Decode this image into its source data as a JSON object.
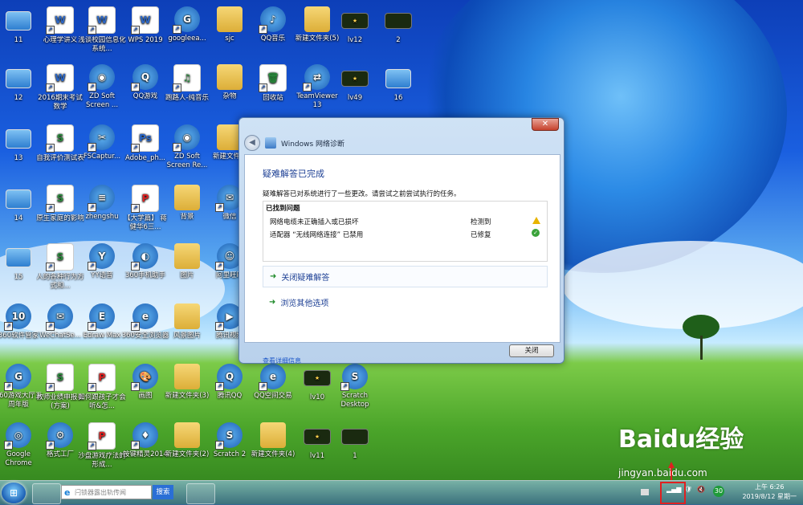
{
  "desktop_icons": [
    {
      "label": "11",
      "kind": "thumb",
      "glyph": ""
    },
    {
      "label": "心理学讲义",
      "kind": "doc",
      "glyph": "W"
    },
    {
      "label": "浅谈校园信息化系统...",
      "kind": "doc",
      "glyph": "W"
    },
    {
      "label": "WPS 2019",
      "kind": "doc",
      "glyph": "W"
    },
    {
      "label": "googleea...",
      "kind": "round",
      "glyph": "G"
    },
    {
      "label": "sjc",
      "kind": "folder",
      "glyph": ""
    },
    {
      "label": "QQ音乐",
      "kind": "round",
      "glyph": "♪"
    },
    {
      "label": "新建文件夹(5)",
      "kind": "folder",
      "glyph": ""
    },
    {
      "label": "lv12",
      "kind": "dark",
      "glyph": "★"
    },
    {
      "label": "2",
      "kind": "dark",
      "glyph": ""
    },
    {
      "label": "12",
      "kind": "thumb",
      "glyph": ""
    },
    {
      "label": "2016期末考试数学",
      "kind": "doc",
      "glyph": "W"
    },
    {
      "label": "ZD Soft Screen ...",
      "kind": "round",
      "glyph": "◉"
    },
    {
      "label": "QQ游戏",
      "kind": "round",
      "glyph": "Q"
    },
    {
      "label": "跑路人-纯音乐",
      "kind": "xls",
      "glyph": "♫"
    },
    {
      "label": "杂物",
      "kind": "folder",
      "glyph": ""
    },
    {
      "label": "回收站",
      "kind": "xls",
      "glyph": "🗑"
    },
    {
      "label": "TeamViewer 13",
      "kind": "round",
      "glyph": "⇄"
    },
    {
      "label": "lv49",
      "kind": "dark",
      "glyph": "★"
    },
    {
      "label": "16",
      "kind": "thumb",
      "glyph": ""
    },
    {
      "label": "13",
      "kind": "thumb",
      "glyph": ""
    },
    {
      "label": "自我评价测试表",
      "kind": "xls",
      "glyph": "S"
    },
    {
      "label": "FSCaptur...",
      "kind": "round",
      "glyph": "✂"
    },
    {
      "label": "Adobe_ph...",
      "kind": "doc",
      "glyph": "Ps"
    },
    {
      "label": "ZD Soft Screen Re...",
      "kind": "round",
      "glyph": "◉"
    },
    {
      "label": "新建文件...",
      "kind": "folder",
      "glyph": ""
    },
    {
      "label": "14",
      "kind": "thumb",
      "glyph": ""
    },
    {
      "label": "原生家庭的影响",
      "kind": "xls",
      "glyph": "S"
    },
    {
      "label": "zhengshu",
      "kind": "round",
      "glyph": "≡"
    },
    {
      "label": "【大学篇】 蒋健华6三...",
      "kind": "pdf",
      "glyph": "P"
    },
    {
      "label": "背景",
      "kind": "folder",
      "glyph": ""
    },
    {
      "label": "微信",
      "kind": "round",
      "glyph": "✉"
    },
    {
      "label": "15",
      "kind": "thumb",
      "glyph": ""
    },
    {
      "label": "人的各种行为方式和...",
      "kind": "xls",
      "glyph": "S"
    },
    {
      "label": "YY语音",
      "kind": "round",
      "glyph": "Y"
    },
    {
      "label": "360手机助手",
      "kind": "round",
      "glyph": "◐"
    },
    {
      "label": "图片",
      "kind": "folder",
      "glyph": ""
    },
    {
      "label": "阿里旺旺",
      "kind": "round",
      "glyph": "☺"
    },
    {
      "label": "360软件管家",
      "kind": "round",
      "glyph": "10"
    },
    {
      "label": "WeChatSe...",
      "kind": "round",
      "glyph": "✉"
    },
    {
      "label": "Edraw Max",
      "kind": "round",
      "glyph": "E"
    },
    {
      "label": "360安全浏览器",
      "kind": "round",
      "glyph": "e"
    },
    {
      "label": "风景图片",
      "kind": "folder",
      "glyph": ""
    },
    {
      "label": "腾讯视频",
      "kind": "round",
      "glyph": "▶"
    },
    {
      "label": "360游戏大厅五周年版",
      "kind": "round",
      "glyph": "G"
    },
    {
      "label": "教师业绩申报表(方案)",
      "kind": "xls",
      "glyph": "S"
    },
    {
      "label": "如何跟孩子才会听&怎...",
      "kind": "pdf",
      "glyph": "P"
    },
    {
      "label": "画图",
      "kind": "round",
      "glyph": "🎨"
    },
    {
      "label": "新建文件夹(3)",
      "kind": "folder",
      "glyph": ""
    },
    {
      "label": "腾讯QQ",
      "kind": "round",
      "glyph": "Q"
    },
    {
      "label": "QQ空间交易",
      "kind": "round",
      "glyph": "e"
    },
    {
      "label": "lv10",
      "kind": "dark",
      "glyph": "★"
    },
    {
      "label": "Scratch Desktop",
      "kind": "round",
      "glyph": "S"
    },
    {
      "label": "Google Chrome",
      "kind": "round",
      "glyph": "◎"
    },
    {
      "label": "格式工厂",
      "kind": "round",
      "glyph": "⚙"
    },
    {
      "label": "沙盘游戏疗法的形成...",
      "kind": "pdf",
      "glyph": "P"
    },
    {
      "label": "按键精灵2014",
      "kind": "round",
      "glyph": "♦"
    },
    {
      "label": "新建文件夹(2)",
      "kind": "folder",
      "glyph": ""
    },
    {
      "label": "Scratch 2",
      "kind": "round",
      "glyph": "S"
    },
    {
      "label": "新建文件夹(4)",
      "kind": "folder",
      "glyph": ""
    },
    {
      "label": "lv11",
      "kind": "dark",
      "glyph": "★"
    },
    {
      "label": "1",
      "kind": "dark",
      "glyph": ""
    }
  ],
  "dialog": {
    "close_x": "✕",
    "back": "◀",
    "title": "Windows 网络诊断",
    "heading": "疑难解答已完成",
    "description": "疑难解答已对系统进行了一些更改。请尝试之前尝试执行的任务。",
    "problems_header": "已找到问题",
    "problems": [
      {
        "text": "网络电缆未正确插入或已损坏",
        "status": "检测到",
        "icon": "warning-icon"
      },
      {
        "text": "适配器 “无线网络连接” 已禁用",
        "status": "已修复",
        "icon": "check-icon"
      }
    ],
    "action_close": "关闭疑难解答",
    "action_more": "浏览其他选项",
    "details_link": "查看详细信息",
    "close_button": "关闭",
    "arrow": "➜"
  },
  "taskbar": {
    "search_placeholder": "闩锁器露出轨传闻",
    "search_button": "搜索",
    "clock_time": "上午 6:26",
    "clock_date": "2019/8/12 星期一",
    "tray_badge": "30"
  },
  "watermark": {
    "brand": "Baidu经验",
    "url": "jingyan.baidu.com"
  }
}
